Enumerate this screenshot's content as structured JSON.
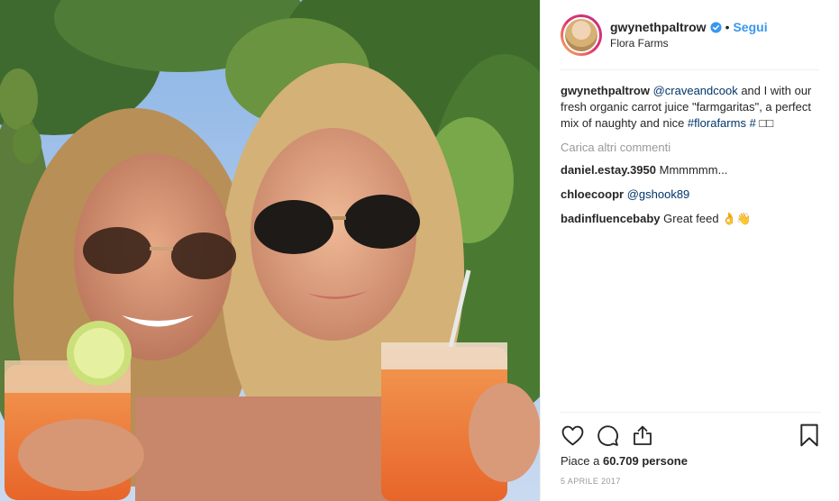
{
  "header": {
    "username": "gwynethpaltrow",
    "separator": "•",
    "follow_label": "Segui",
    "location": "Flora Farms"
  },
  "caption": {
    "username": "gwynethpaltrow",
    "mention": "@craveandcook",
    "text": " and I with our fresh organic carrot juice \"farmgaritas\", a perfect mix of naughty and nice ",
    "hashtag": "#florafarms",
    "hashtag2": "#",
    "tail": " □□"
  },
  "load_more_label": "Carica altri commenti",
  "comments": [
    {
      "username": "daniel.estay.3950",
      "text": " Mmmmmm..."
    },
    {
      "username": "chloecoopr",
      "mention": "@gshook89"
    },
    {
      "username": "badinfluencebaby",
      "text": " Great feed 👌👋"
    }
  ],
  "likes": {
    "prefix": "Piace a ",
    "count": "60.709",
    "suffix": " persone"
  },
  "date": "5 APRILE 2017",
  "icons": [
    "heart-icon",
    "comment-icon",
    "share-icon",
    "bookmark-icon",
    "verified-badge-icon"
  ],
  "colors": {
    "accent": "#3897f0",
    "link": "#003569",
    "muted": "#999999"
  }
}
